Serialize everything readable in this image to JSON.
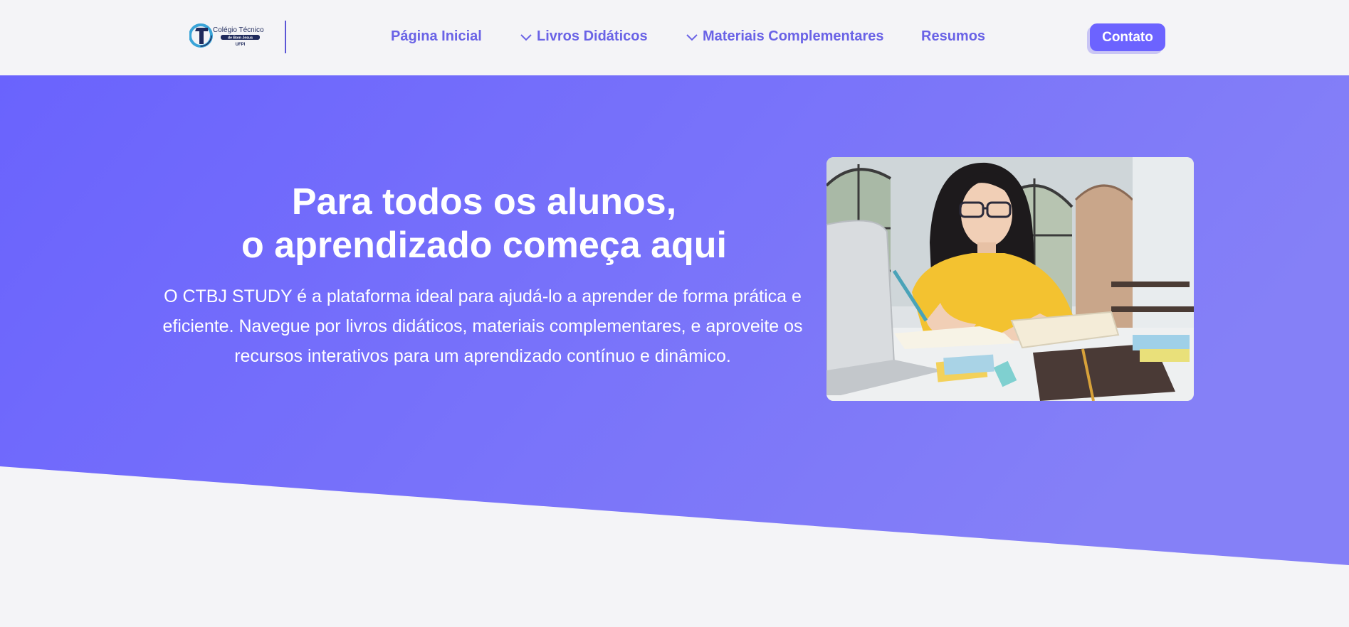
{
  "header": {
    "logo": {
      "name": "Colégio Técnico",
      "sub": "de Bom Jesus",
      "org": "UFPI"
    },
    "nav": [
      {
        "label": "Página Inicial",
        "dropdown": false
      },
      {
        "label": "Livros Didáticos",
        "dropdown": true
      },
      {
        "label": "Materiais Complementares",
        "dropdown": true
      },
      {
        "label": "Resumos",
        "dropdown": false
      }
    ],
    "contact_label": "Contato"
  },
  "hero": {
    "title_line1": "Para todos os alunos,",
    "title_line2": "o aprendizado começa aqui",
    "description": "O CTBJ STUDY é a plataforma ideal para ajudá-lo a aprender de forma prática e eficiente. Navegue por livros didáticos, materiais complementares, e aproveite os recursos interativos para um aprendizado contínuo e dinâmico.",
    "photo": "student-studying-photo"
  },
  "colors": {
    "accent": "#6c63ff",
    "nav_text": "#6a63e6",
    "hero_gradient_start": "#6a63fd",
    "hero_gradient_end": "#8580f7",
    "background": "#f4f4f7"
  }
}
